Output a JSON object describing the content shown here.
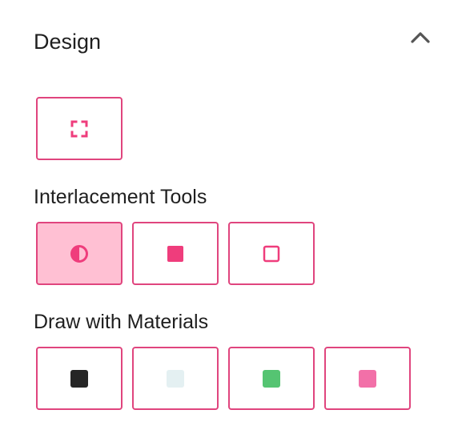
{
  "panel": {
    "title": "Design",
    "collapse_icon": "chevron-up-icon"
  },
  "fullscreen_tool": {
    "icon": "fullscreen-icon",
    "color": "#ef3d7c"
  },
  "interlacement": {
    "label": "Interlacement Tools",
    "tools": [
      {
        "name": "contrast",
        "icon": "half-circle-icon",
        "active": true
      },
      {
        "name": "filled",
        "icon": "filled-square-icon",
        "active": false
      },
      {
        "name": "empty",
        "icon": "outline-square-icon",
        "active": false
      }
    ],
    "accent_color": "#ef3d7c"
  },
  "materials": {
    "label": "Draw with Materials",
    "swatches": [
      {
        "name": "black",
        "color": "#262626"
      },
      {
        "name": "light",
        "color": "#e4f0f2"
      },
      {
        "name": "green",
        "color": "#55c472"
      },
      {
        "name": "pink",
        "color": "#f270a8"
      }
    ]
  },
  "colors": {
    "border": "#e0457e",
    "active_background": "#ffc0d3",
    "text": "#1f1f1f",
    "chevron": "#555555"
  }
}
